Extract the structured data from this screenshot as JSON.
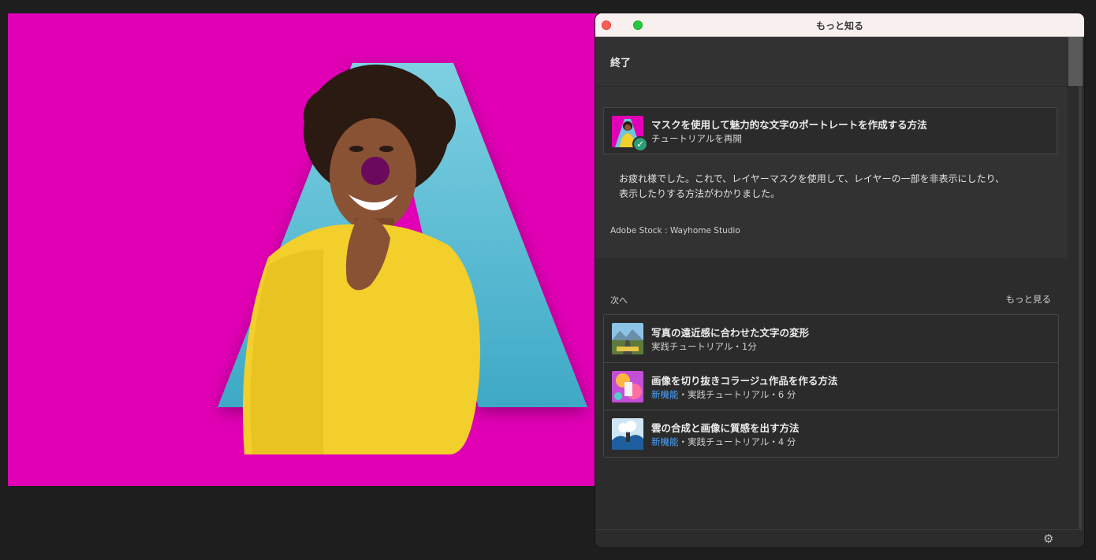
{
  "window": {
    "title": "もっと知る"
  },
  "header": {
    "end_label": "終了"
  },
  "current_tutorial": {
    "title": "マスクを使用して魅力的な文字のポートレートを作成する方法",
    "subtitle": "チュートリアルを再開",
    "completed": true
  },
  "completion_message": {
    "line1": "お疲れ様でした。これで、レイヤーマスクを使用して、レイヤーの一部を非表示にしたり、",
    "line2": "表示したりする方法がわかりました。"
  },
  "credit": "Adobe Stock : Wayhome Studio",
  "next_section": {
    "label": "次へ",
    "more_label": "もっと見る",
    "items": [
      {
        "title": "写真の遠近感に合わせた文字の変形",
        "badge": "",
        "meta": "実践チュートリアル・1分"
      },
      {
        "title": "画像を切り抜きコラージュ作品を作る方法",
        "badge": "新機能",
        "meta": "・実践チュートリアル・6 分"
      },
      {
        "title": "雲の合成と画像に質感を出す方法",
        "badge": "新機能",
        "meta": "・実践チュートリアル・4 分"
      }
    ]
  },
  "colors": {
    "canvas_magenta": "#e100b5",
    "letter_blue": "#6cc6dc",
    "sweater_yellow": "#f2cf2a",
    "new_badge_blue": "#4ba3ff",
    "check_green": "#2d9d78"
  },
  "icons": {
    "close": "close-traffic-icon",
    "zoom": "zoom-traffic-icon",
    "check": "checkmark-icon",
    "settings": "gear-icon"
  }
}
